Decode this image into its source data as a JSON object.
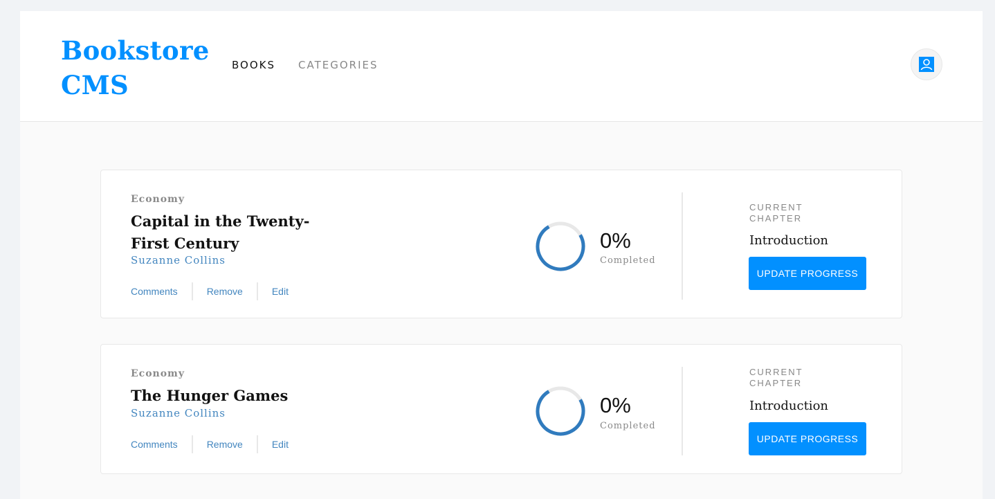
{
  "header": {
    "brand": "Bookstore CMS",
    "nav": {
      "books": "BOOKS",
      "categories": "CATEGORIES"
    },
    "user_icon": "user-icon",
    "accent_color": "#0290ff"
  },
  "books": [
    {
      "category": "Economy",
      "title": "Capital in the Twenty-First Century",
      "author": "Suzanne Collins",
      "actions": {
        "comments": "Comments",
        "remove": "Remove",
        "edit": "Edit"
      },
      "progress_percent": "0%",
      "progress_value": 0,
      "completed_label": "Completed",
      "chapter_label": "CURRENT CHAPTER",
      "chapter": "Introduction",
      "update_label": "UPDATE PROGRESS"
    },
    {
      "category": "Economy",
      "title": "The Hunger Games",
      "author": "Suzanne Collins",
      "actions": {
        "comments": "Comments",
        "remove": "Remove",
        "edit": "Edit"
      },
      "progress_percent": "0%",
      "progress_value": 0,
      "completed_label": "Completed",
      "chapter_label": "CURRENT CHAPTER",
      "chapter": "Introduction",
      "update_label": "UPDATE PROGRESS"
    }
  ],
  "colors": {
    "ring_track": "#e8e8e8",
    "ring_fill": "#307bbe",
    "link": "#4386bf"
  }
}
